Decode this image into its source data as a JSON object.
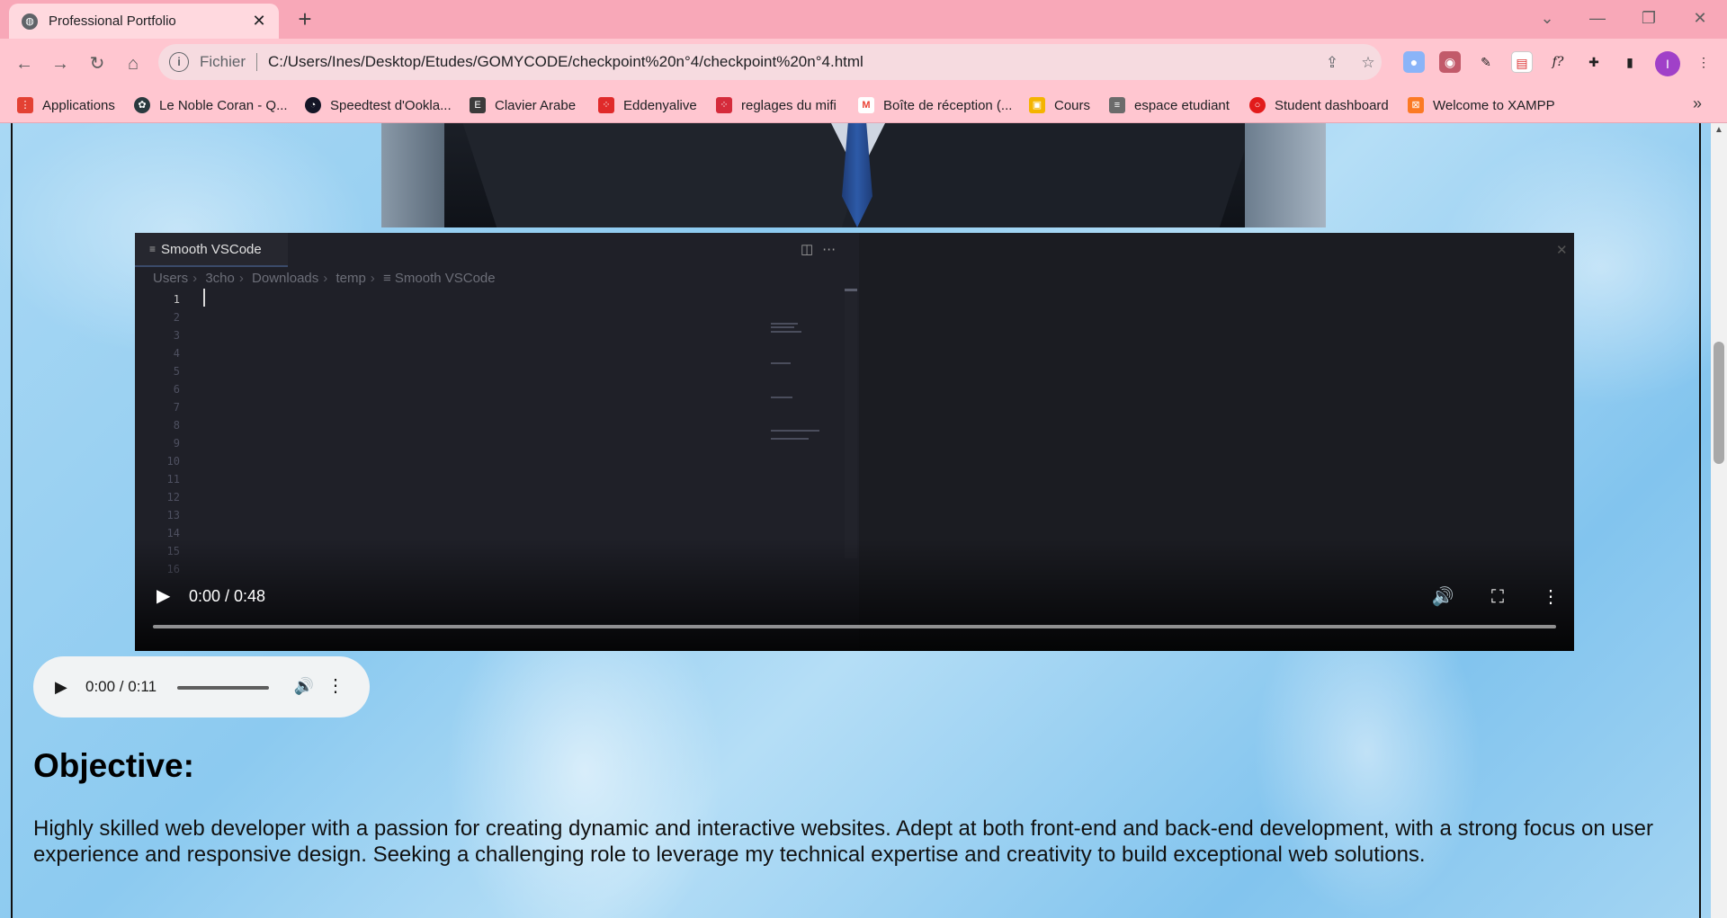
{
  "browser": {
    "tab_title": "Professional Portfolio",
    "tab_close": "✕",
    "new_tab": "+",
    "window_controls": [
      "⌄",
      "—",
      "❐",
      "✕"
    ],
    "omnibox": {
      "scheme_label": "Fichier",
      "url": "C:/Users/Ines/Desktop/Etudes/GOMYCODE/checkpoint%20n°4/checkpoint%20n°4.html"
    },
    "profile_initial": "I",
    "bookmarks": [
      {
        "label": "Applications",
        "icon": "apps-grid-icon",
        "color": "#e34133"
      },
      {
        "label": "Le Noble Coran - Q...",
        "icon": "quran-icon",
        "color": "#2a3a3f"
      },
      {
        "label": "Speedtest d'Ookla...",
        "icon": "speedtest-icon",
        "color": "#141526"
      },
      {
        "label": "Clavier Arabe",
        "icon": "keyboard-icon",
        "color": "#3b3b3b"
      },
      {
        "label": "Eddenyalive",
        "icon": "eddenyalive-icon",
        "color": "#e02a2a"
      },
      {
        "label": "reglages du mifi",
        "icon": "mifi-icon",
        "color": "#d52b3b"
      },
      {
        "label": "Boîte de réception (...",
        "icon": "gmail-icon",
        "color": "#ea4335"
      },
      {
        "label": "Cours",
        "icon": "classroom-icon",
        "color": "#f4b400"
      },
      {
        "label": "espace etudiant",
        "icon": "student-space-icon",
        "color": "#6b6b6b"
      },
      {
        "label": "Student dashboard",
        "icon": "dashboard-icon",
        "color": "#e21b1b"
      },
      {
        "label": "Welcome to XAMPP",
        "icon": "xampp-icon",
        "color": "#fb7a24"
      }
    ],
    "bookmarks_overflow": "»"
  },
  "page": {
    "video": {
      "editor_tab": "Smooth VSCode",
      "breadcrumbs": [
        "Users",
        "3cho",
        "Downloads",
        "temp",
        "Smooth VSCode"
      ],
      "line_numbers": [
        "1",
        "2",
        "3",
        "4",
        "5",
        "6",
        "7",
        "8",
        "9",
        "10",
        "11",
        "12",
        "13",
        "14",
        "15",
        "16"
      ],
      "time": "0:00 / 0:48",
      "progress": 0
    },
    "audio": {
      "time": "0:00 / 0:11",
      "progress": 0
    },
    "objective": {
      "heading": "Objective:",
      "text": "Highly skilled web developer with a passion for creating dynamic and interactive websites. Adept at both front-end and back-end development, with a strong focus on user experience and responsive design. Seeking a challenging role to leverage my technical expertise and creativity to build exceptional web solutions."
    }
  },
  "colors": {
    "tabbar": "#f8a8b8",
    "toolbar": "#ffc6d0",
    "page_background": "#8ccaf0",
    "profile": "#a040c8"
  }
}
